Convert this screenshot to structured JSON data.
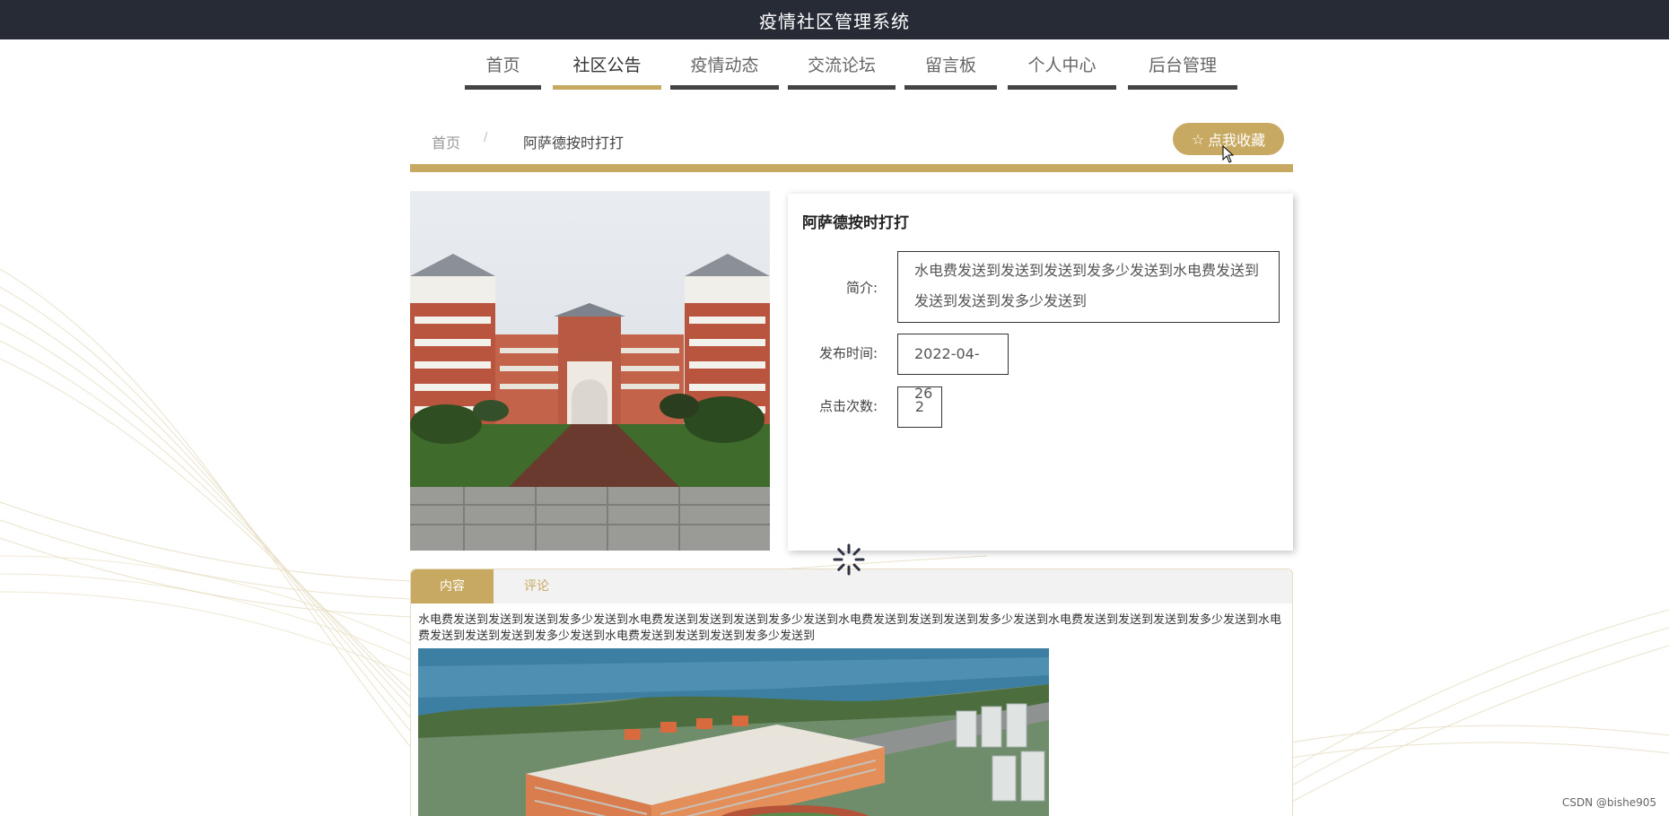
{
  "header": {
    "title": "疫情社区管理系统"
  },
  "nav": {
    "items": [
      {
        "label": "首页"
      },
      {
        "label": "社区公告",
        "active": true
      },
      {
        "label": "疫情动态"
      },
      {
        "label": "交流论坛"
      },
      {
        "label": "留言板"
      },
      {
        "label": "个人中心"
      },
      {
        "label": "后台管理"
      }
    ]
  },
  "breadcrumb": {
    "home": "首页",
    "separator": "/",
    "current": "阿萨德按时打打"
  },
  "favorite_button": {
    "label": "点我收藏",
    "icon": "star-outline-icon"
  },
  "detail": {
    "title": "阿萨德按时打打",
    "intro_label": "简介:",
    "intro_value": "水电费发送到发送到发送到发多少发送到水电费发送到发送到发送到发多少发送到",
    "publish_label": "发布时间:",
    "publish_value": "2022-04-26",
    "clicks_label": "点击次数:",
    "clicks_value": "2"
  },
  "tabs": {
    "content": "内容",
    "comments": "评论"
  },
  "content": {
    "text": "水电费发送到发送到发送到发多少发送到水电费发送到发送到发送到发多少发送到水电费发送到发送到发送到发多少发送到水电费发送到发送到发送到发多少发送到水电费发送到发送到发送到发多少发送到水电费发送到发送到发送到发多少发送到"
  },
  "watermark": "CSDN @bishe905",
  "colors": {
    "accent": "#c8a962",
    "topbar": "#262b36",
    "nav_bar": "#444444"
  }
}
